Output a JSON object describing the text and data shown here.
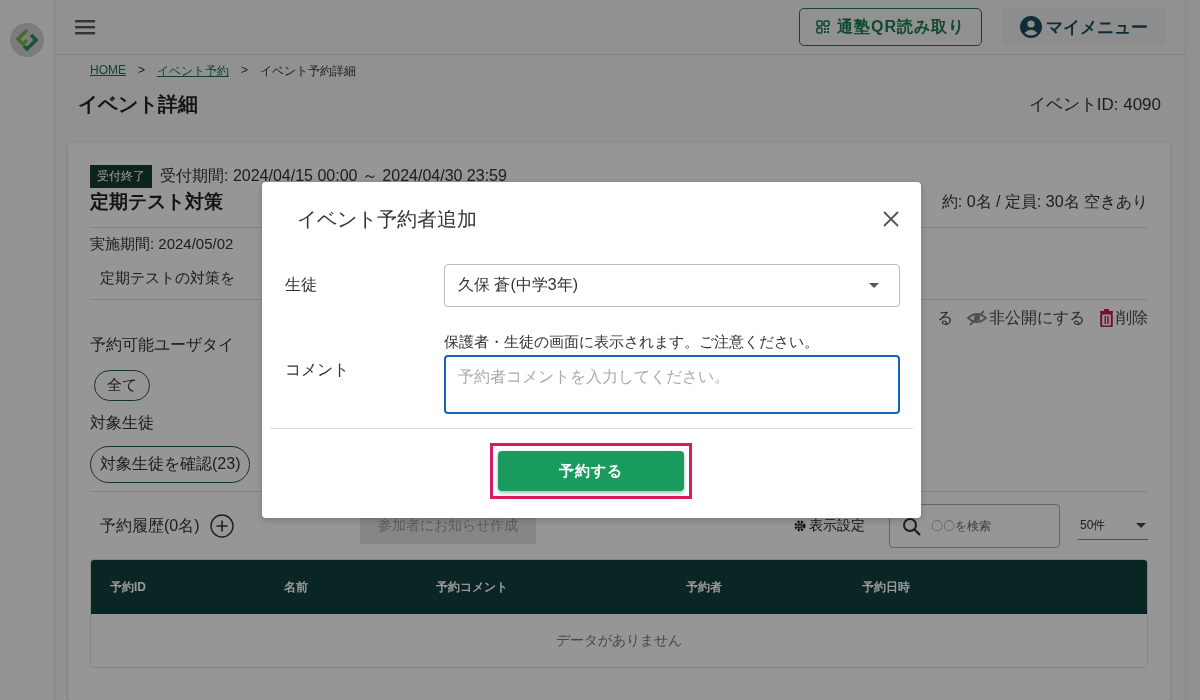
{
  "header": {
    "qr_button": "通塾QR読み取り",
    "my_menu": "マイメニュー"
  },
  "breadcrumb": [
    {
      "kind": "link",
      "label": "HOME"
    },
    {
      "kind": "separator",
      "label": ">"
    },
    {
      "kind": "link",
      "label": "イベント予約"
    },
    {
      "kind": "separator",
      "label": ">"
    },
    {
      "kind": "current",
      "label": "イベント予約詳細"
    }
  ],
  "page": {
    "title": "イベント詳細",
    "event_id": "イベントID: 4090"
  },
  "event": {
    "status_badge": "受付終了",
    "reception_period": "受付期間: 2024/04/15 00:00 ～ 2024/04/30 23:59",
    "name": "定期テスト対策",
    "capacity": "約: 0名 / 定員: 30名 空きあり",
    "period": "実施期間: 2024/05/02",
    "description": "定期テストの対策を",
    "actions": [
      {
        "kind": "text",
        "label": "る"
      },
      {
        "kind": "hide",
        "label": "非公開にする"
      },
      {
        "kind": "delete",
        "label": "削除"
      }
    ],
    "user_type_label": "予約可能ユーザタイ",
    "user_types": [
      "全て"
    ],
    "target_label": "対象生徒",
    "target_button": "対象生徒を確認(23)"
  },
  "reservations": {
    "title": "予約履歴(0名)",
    "notify_button": {
      "label": "参加者にお知らせ作成",
      "disabled": true
    },
    "display_settings": "表示設定",
    "search": {
      "placeholder": "〇〇を検索"
    },
    "page_size": "50件",
    "table": {
      "columns": [
        "予約ID",
        "名前",
        "予約コメント",
        "予約者",
        "予約日時"
      ],
      "empty_message": "データがありません"
    }
  },
  "dialog": {
    "title": "イベント予約者追加",
    "fields": [
      {
        "kind": "select",
        "label": "生徒",
        "value": "久保 蒼(中学3年)"
      },
      {
        "kind": "textarea",
        "label": "コメント",
        "note": "保護者・生徒の画面に表示されます。ご注意ください。",
        "placeholder": "予約者コメントを入力してください。",
        "focused": true
      }
    ],
    "submit": {
      "label": "予約する",
      "highlighted": true
    }
  }
}
